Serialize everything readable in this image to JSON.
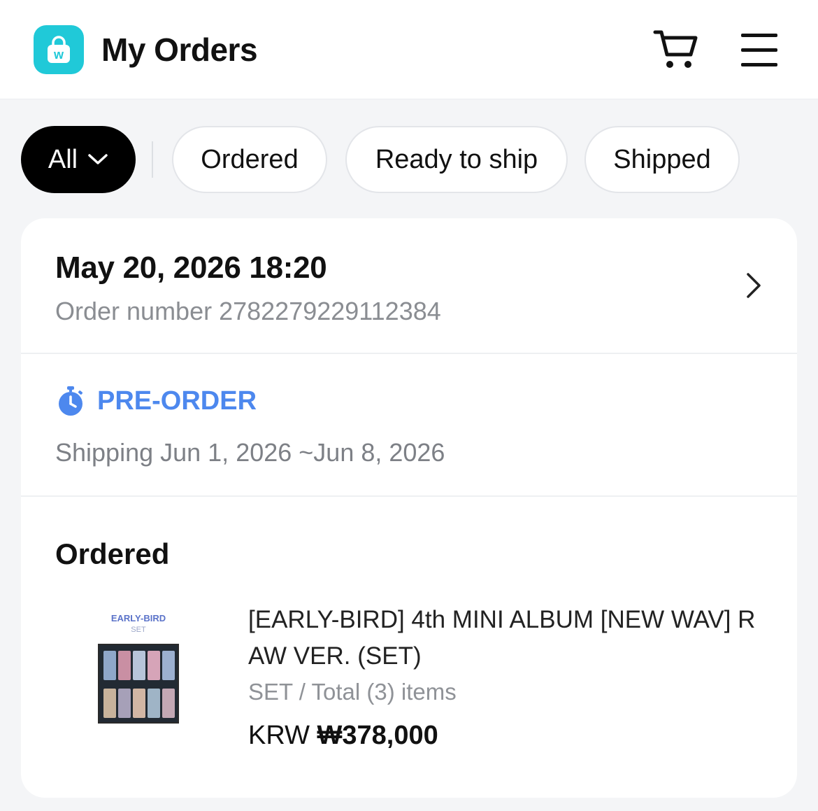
{
  "header": {
    "title": "My Orders",
    "logo_letter": "w",
    "accent_color": "#20c9d8"
  },
  "filters": {
    "items": [
      {
        "label": "All",
        "active": true,
        "icon": "chevron-down-icon"
      },
      {
        "label": "Ordered",
        "active": false
      },
      {
        "label": "Ready to ship",
        "active": false
      },
      {
        "label": "Shipped",
        "active": false
      }
    ]
  },
  "order": {
    "date": "May 20, 2026 18:20",
    "number_label": "Order number 2782279229112384",
    "preorder_label": "PRE-ORDER",
    "preorder_color": "#4d88ee",
    "shipping": "Shipping Jun 1, 2026 ~Jun 8, 2026",
    "status": "Ordered",
    "item": {
      "thumb_label": "EARLY-BIRD",
      "thumb_sub": "SET",
      "name": "[EARLY-BIRD] 4th MINI ALBUM [NEW WAV] RAW VER. (SET)",
      "option": "SET / Total (3) items",
      "currency": "KRW",
      "price": "₩378,000"
    }
  }
}
